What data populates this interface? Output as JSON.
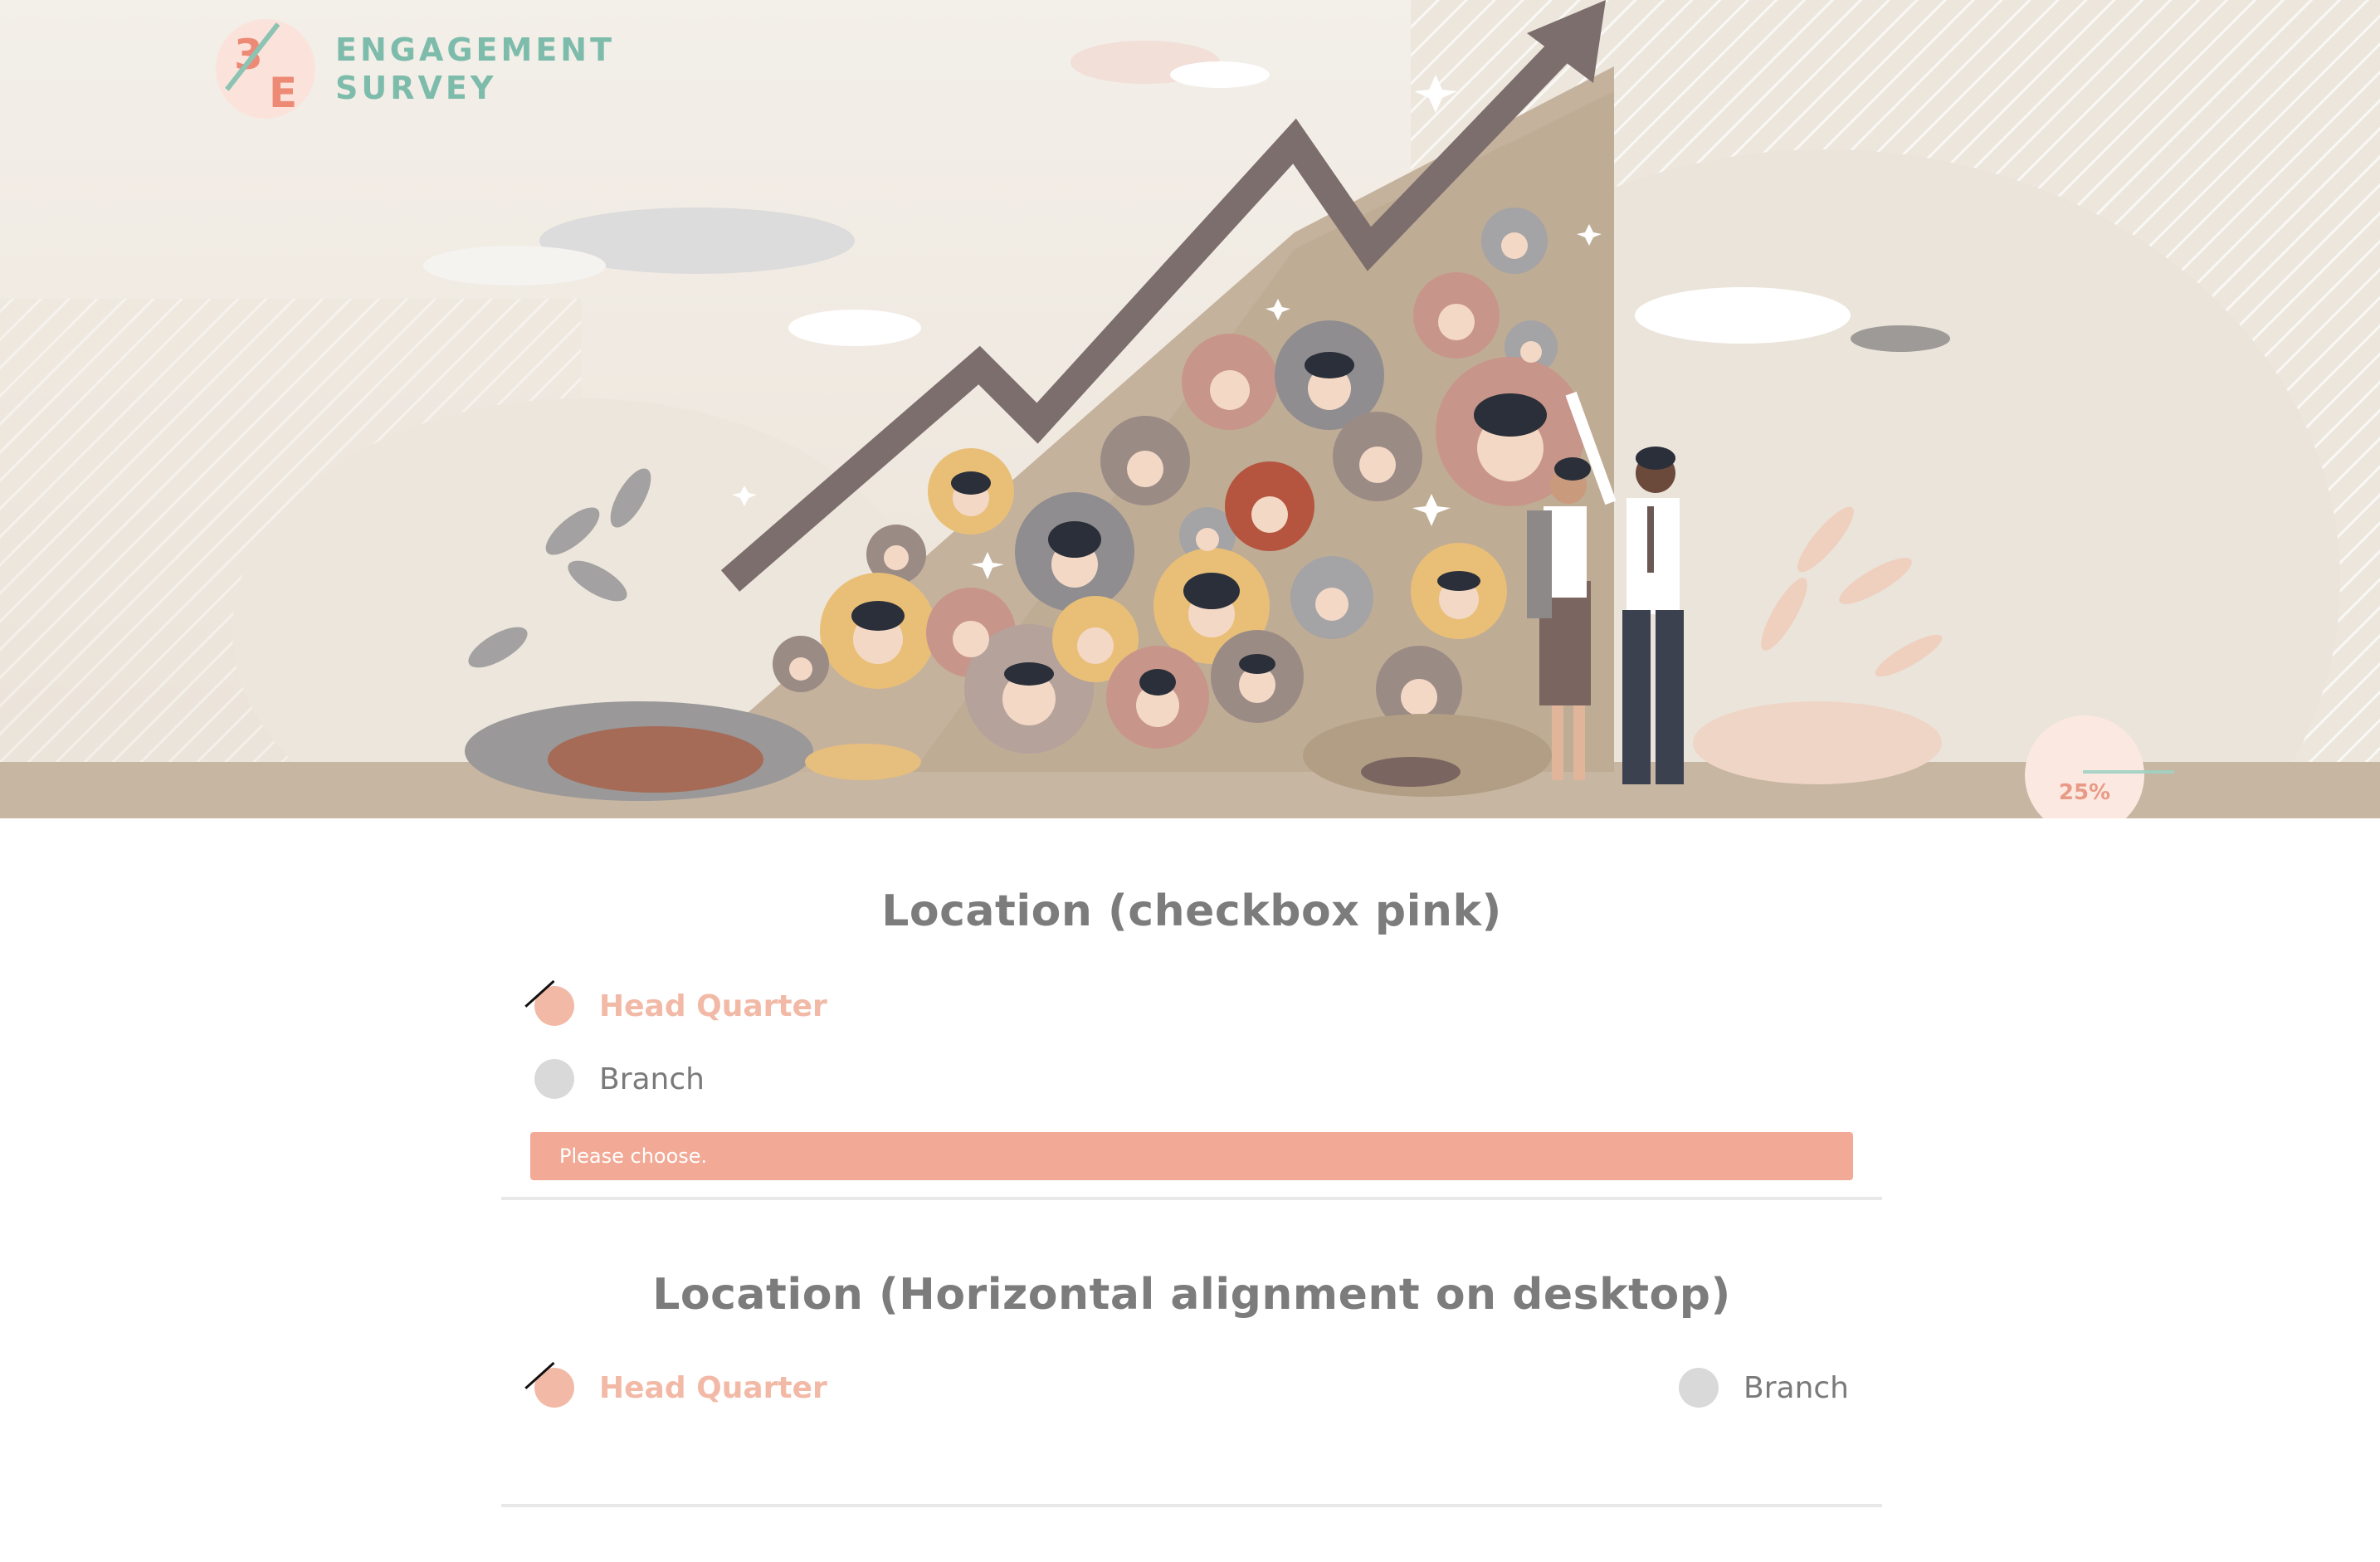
{
  "logo": {
    "mark_top": "3",
    "mark_bottom": "E",
    "line1": "ENGAGEMENT",
    "line2": "SURVEY"
  },
  "progress": {
    "percent_label": "25%",
    "value": 0.25
  },
  "questions": [
    {
      "title": "Location (checkbox pink)",
      "options": [
        {
          "label": "Head Quarter",
          "checked": true
        },
        {
          "label": "Branch",
          "checked": false
        }
      ],
      "error": "Please choose."
    },
    {
      "title": "Location (Horizontal alignment on desktop)",
      "options": [
        {
          "label": "Head Quarter",
          "checked": true
        },
        {
          "label": "Branch",
          "checked": false
        }
      ]
    }
  ],
  "colors": {
    "accent_pink": "#f2b9a6",
    "error_bg": "#f2a996",
    "logo_teal": "#7dbcab",
    "logo_coral": "#ed8a76",
    "title_gray": "#7c7c7c"
  },
  "icons": {
    "hero": "growth-chart-illustration",
    "check": "check-icon"
  }
}
